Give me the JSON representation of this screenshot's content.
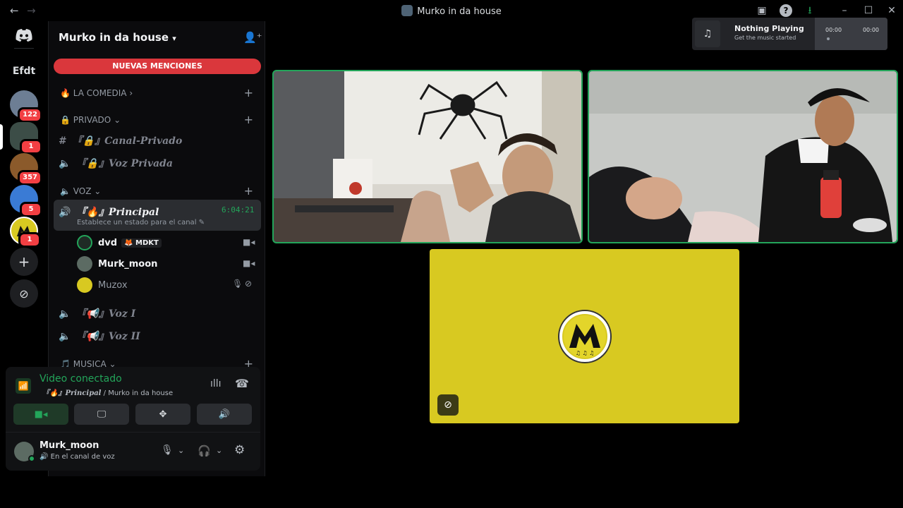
{
  "window": {
    "title": "Murko in da house"
  },
  "server": {
    "name": "Murko in da house",
    "mention_banner": "NUEVAS MENCIONES",
    "text_abbr": "Efdt"
  },
  "rail_badges": [
    "122",
    "1",
    "357",
    "5",
    "1"
  ],
  "categories": [
    {
      "label": "LA COMEDIA",
      "icon": "fire-icon"
    },
    {
      "label": "PRIVADO",
      "icon": "lock-icon"
    },
    {
      "label": "VOZ",
      "icon": "speaker-icon"
    },
    {
      "label": "MUSICA",
      "icon": "music-icon"
    }
  ],
  "channels": {
    "canal_privado": "『🔒』Canal-Privado",
    "voz_privada": "『🔒』Voz Privada",
    "principal": "『🔥』Principal",
    "principal_timer": "6:04:21",
    "principal_status": "Establece un estado para el canal",
    "voz_1": "『📢』Voz I",
    "voz_2": "『📢』Voz II"
  },
  "members": [
    {
      "name": "dvd",
      "tag": "MDKT",
      "icon": "video-icon"
    },
    {
      "name": "Murk_moon",
      "icon": "video-icon"
    },
    {
      "name": "Muzox",
      "icons": [
        "mic-muted-icon",
        "deafened-icon"
      ]
    }
  ],
  "voice_panel": {
    "status": "Video conectado",
    "channel": "『🔥』Principal",
    "server": "Murko in da house",
    "user": "Murk_moon",
    "user_status": "En el canal de voz"
  },
  "now_playing": {
    "title": "Nothing Playing",
    "subtitle": "Get the music started",
    "time_start": "00:00",
    "time_end": "00:00"
  },
  "colors": {
    "accent_green": "#23a55a",
    "mention_red": "#da373c",
    "tile_yellow": "#d8c921"
  }
}
